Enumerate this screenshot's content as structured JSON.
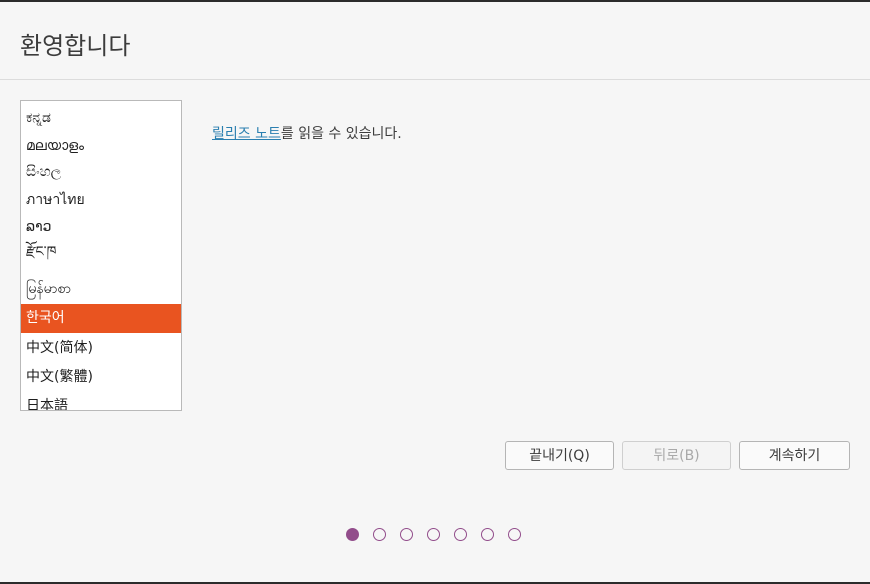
{
  "header": {
    "title": "환영합니다"
  },
  "languages": {
    "items": [
      {
        "label": "ಕನ್ನಡ",
        "selected": false
      },
      {
        "label": "മലയാളം",
        "selected": false
      },
      {
        "label": "සිංහල",
        "selected": false
      },
      {
        "label": "ภาษาไทย",
        "selected": false
      },
      {
        "label": "ລາວ",
        "selected": false
      },
      {
        "label": "རྫོང་ཁ",
        "selected": false
      },
      {
        "label": "မြန်မာစာ",
        "selected": false
      },
      {
        "label": "한국어",
        "selected": true
      },
      {
        "label": "中文(简体)",
        "selected": false
      },
      {
        "label": "中文(繁體)",
        "selected": false
      },
      {
        "label": "日本語",
        "selected": false
      }
    ]
  },
  "release_notes": {
    "link_text": "릴리즈 노트",
    "suffix_text": "를 읽을 수 있습니다."
  },
  "buttons": {
    "quit": "끝내기(Q)",
    "back": "뒤로(B)",
    "continue": "계속하기"
  },
  "progress": {
    "total_steps": 7,
    "current_step": 1
  },
  "colors": {
    "accent": "#e95420",
    "progress_dot": "#924d8b"
  }
}
